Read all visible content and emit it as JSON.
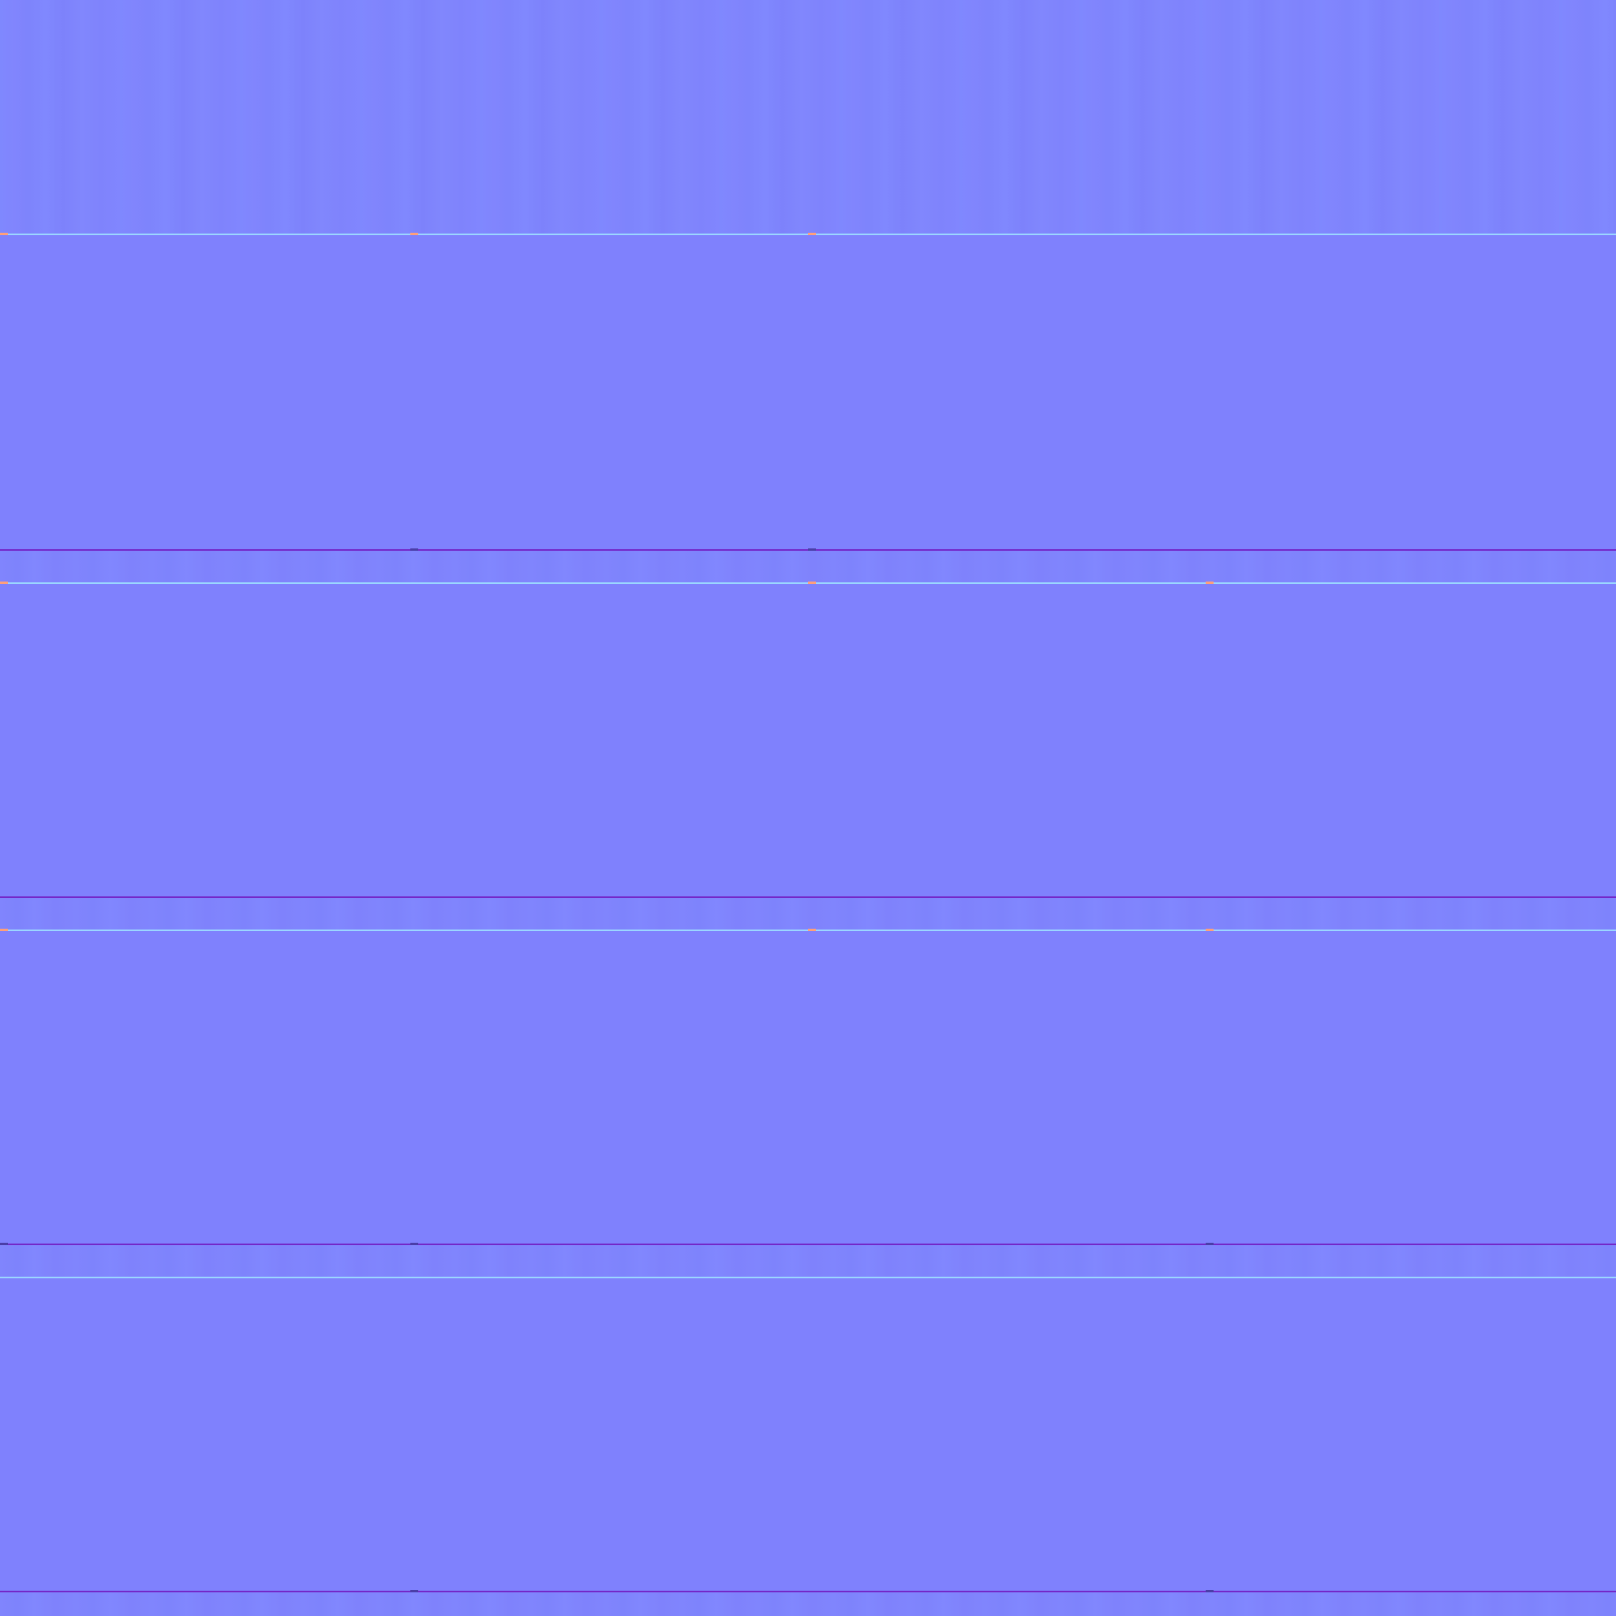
{
  "texture": {
    "type": "normal-map-seams",
    "base_color": "#7f81fd",
    "top_band_color": "#8086fe",
    "gap_band_color": "#8085fd",
    "seam_top_color": "#9bd6ff",
    "seam_bottom_color": "#7427c8",
    "node_warm_color": "#ff9f7a",
    "node_dark_color": "#4a3ea8"
  }
}
